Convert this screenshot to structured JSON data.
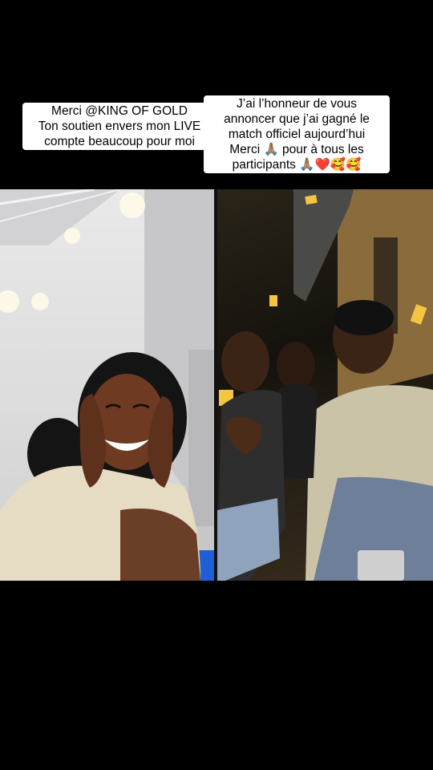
{
  "captions": {
    "left": {
      "lines": [
        "Merci @KING OF GOLD",
        "Ton soutien envers mon LIVE",
        "compte beaucoup pour moi"
      ]
    },
    "right": {
      "lines": [
        "J’ai l’honneur de vous",
        "annoncer que j’ai gagné le",
        "match officiel aujourd’hui",
        "Merci 🙏🏽 pour à tous les",
        "participants 🙏🏽❤️🥰🥰"
      ]
    }
  },
  "colors": {
    "background": "#000000",
    "caption_bg": "#ffffff",
    "caption_text": "#000000"
  }
}
